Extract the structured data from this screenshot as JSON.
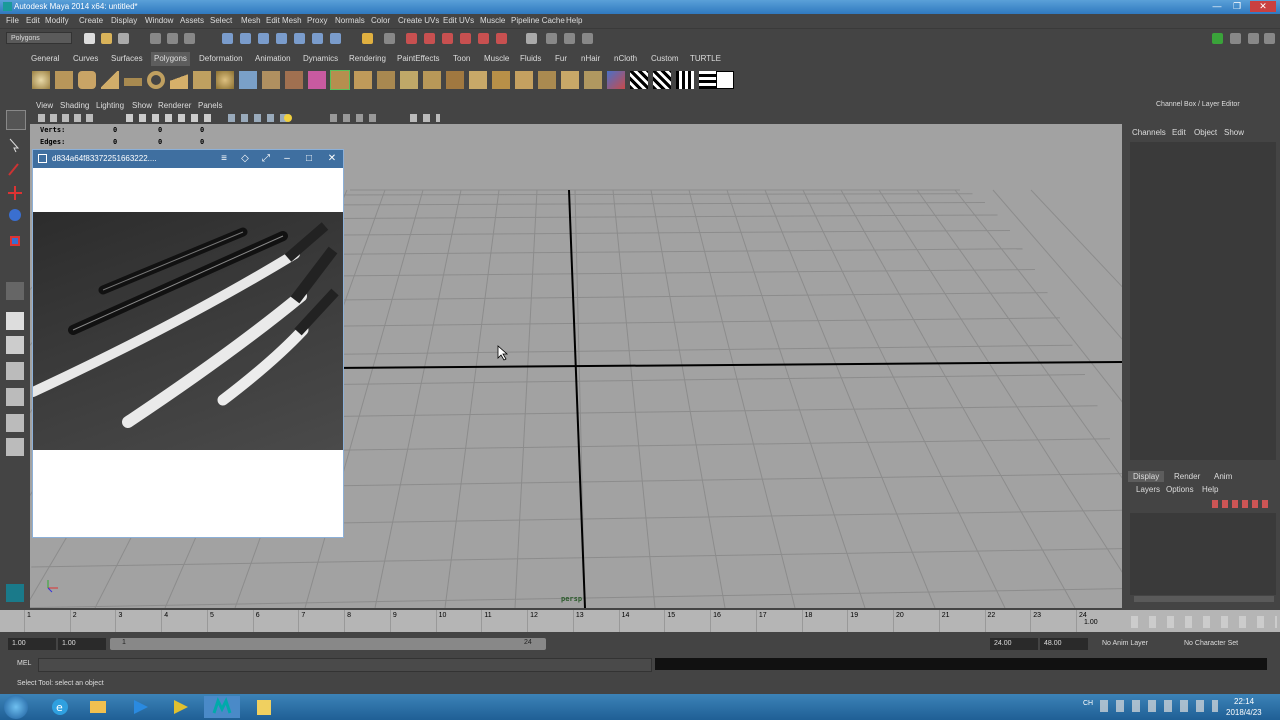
{
  "window": {
    "title": "Autodesk Maya 2014 x64: untitled*",
    "controls": [
      "—",
      "❐",
      "✕"
    ]
  },
  "menubar": {
    "items": [
      "File",
      "Edit",
      "Modify",
      "Create",
      "Display",
      "Window",
      "Assets",
      "Select",
      "Mesh",
      "Edit Mesh",
      "Proxy",
      "Normals",
      "Color",
      "Create UVs",
      "Edit UVs",
      "Muscle",
      "Pipeline Cache",
      "Help"
    ]
  },
  "statusline": {
    "mode_select": "Polygons"
  },
  "shelf": {
    "tabs": [
      "General",
      "Curves",
      "Surfaces",
      "Polygons",
      "Deformation",
      "Animation",
      "Dynamics",
      "Rendering",
      "PaintEffects",
      "Toon",
      "Muscle",
      "Fluids",
      "Fur",
      "nHair",
      "nCloth",
      "Custom",
      "TURTLE"
    ],
    "active_tab": "Polygons"
  },
  "viewport": {
    "menu": [
      "View",
      "Shading",
      "Lighting",
      "Show",
      "Renderer",
      "Panels"
    ],
    "hud": {
      "verts_label": "Verts:",
      "verts_vals": [
        "0",
        "0",
        "0"
      ],
      "edges_label": "Edges:",
      "edges_vals": [
        "0",
        "0",
        "0"
      ]
    },
    "camera_label": "persp"
  },
  "image_viewer": {
    "title": "d834a64f83372251663222...."
  },
  "channel_box": {
    "title": "Channel Box / Layer Editor",
    "menu": [
      "Channels",
      "Edit",
      "Object",
      "Show"
    ],
    "layer_tabs": [
      "Display",
      "Render",
      "Anim"
    ],
    "layer_tab_active": "Display",
    "layer_menu": [
      "Layers",
      "Options",
      "Help"
    ]
  },
  "timeslider": {
    "ticks": [
      "1",
      "2",
      "3",
      "4",
      "5",
      "6",
      "7",
      "8",
      "9",
      "10",
      "11",
      "12",
      "13",
      "14",
      "15",
      "16",
      "17",
      "18",
      "19",
      "20",
      "21",
      "22",
      "23",
      "24"
    ],
    "current_frame": "1.00"
  },
  "range": {
    "start": "1.00",
    "playback_start": "1.00",
    "range_marker_start": "1",
    "range_marker_end": "24",
    "playback_end": "24.00",
    "end": "48.00",
    "anim_layer": "No Anim Layer",
    "character_set": "No Character Set"
  },
  "cmdline": {
    "label": "MEL"
  },
  "helpline": {
    "text": "Select Tool: select an object"
  },
  "taskbar": {
    "clock_time": "22:14",
    "clock_date": "2018/4/23",
    "ime": "CH"
  },
  "colors": {
    "viewport_bg": "#a2a2a2",
    "ui_bg": "#444444",
    "titlebar": "#2f79bf",
    "active_tab": "#5d5d5d"
  }
}
